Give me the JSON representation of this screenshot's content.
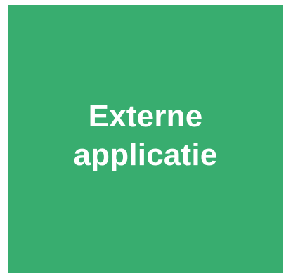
{
  "box": {
    "line1": "Externe",
    "line2": "applicatie",
    "fill_color": "#38ad6f",
    "text_color": "#ffffff"
  }
}
